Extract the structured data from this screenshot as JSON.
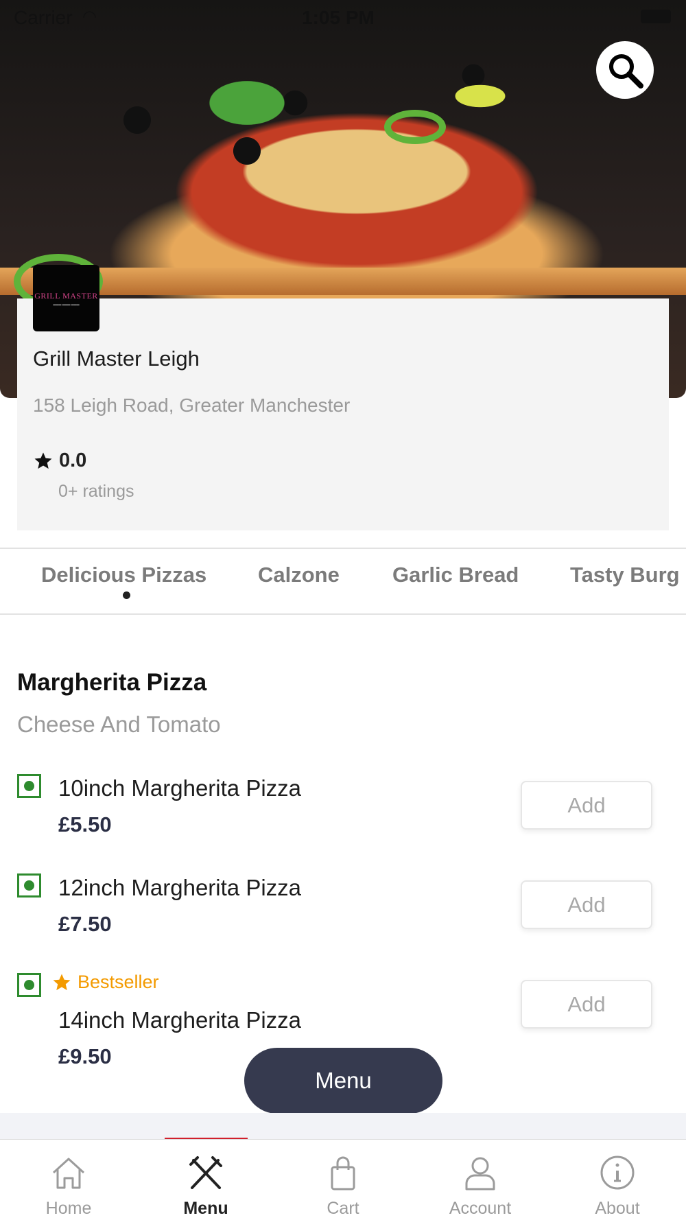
{
  "status_bar": {
    "carrier": "Carrier",
    "time": "1:05 PM"
  },
  "restaurant": {
    "logo_text": "GRILL MASTER",
    "name": "Grill Master Leigh",
    "address": "158 Leigh Road, Greater Manchester",
    "rating": "0.0",
    "rating_count": "0+ ratings"
  },
  "categories": [
    {
      "label": "Delicious Pizzas",
      "active": true
    },
    {
      "label": "Calzone",
      "active": false
    },
    {
      "label": "Garlic Bread",
      "active": false
    },
    {
      "label": "Tasty Burg",
      "active": false
    }
  ],
  "section": {
    "title": "Margherita Pizza",
    "subtitle": "Cheese And Tomato",
    "items": [
      {
        "name": "10inch Margherita Pizza",
        "price": "£5.50",
        "add_label": "Add",
        "bestseller": false
      },
      {
        "name": "12inch Margherita Pizza",
        "price": "£7.50",
        "add_label": "Add",
        "bestseller": false
      },
      {
        "name": "14inch Margherita Pizza",
        "price": "£9.50",
        "add_label": "Add",
        "bestseller": true,
        "badge": "Bestseller"
      }
    ]
  },
  "menu_button": "Menu",
  "bottom_nav": [
    {
      "label": "Home",
      "icon": "home-icon",
      "active": false
    },
    {
      "label": "Menu",
      "icon": "cutlery-icon",
      "active": true
    },
    {
      "label": "Cart",
      "icon": "shopping-bag-icon",
      "active": false
    },
    {
      "label": "Account",
      "icon": "user-icon",
      "active": false
    },
    {
      "label": "About",
      "icon": "info-icon",
      "active": false
    }
  ],
  "colors": {
    "accent_active_nav": "#d11f2c",
    "menu_button_bg": "#363a4f",
    "veg_green": "#2e8b2e",
    "bestseller_orange": "#f39a00",
    "price_text": "#2b2f45"
  }
}
